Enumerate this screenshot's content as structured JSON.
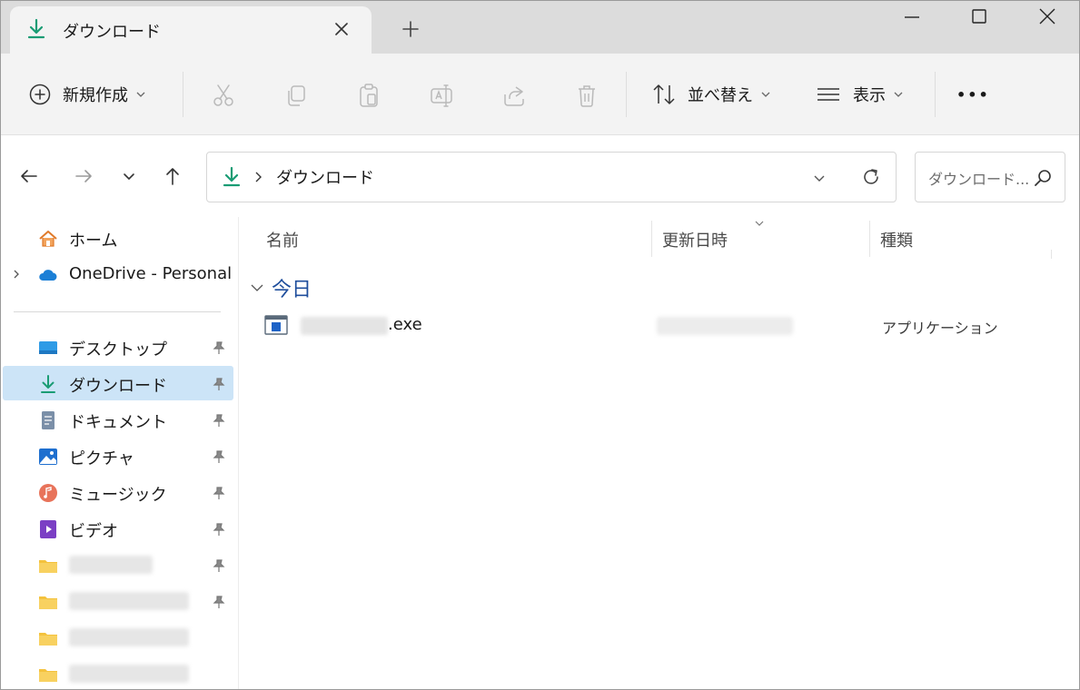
{
  "tab": {
    "title": "ダウンロード"
  },
  "toolbar": {
    "new_label": "新規作成",
    "sort_label": "並べ替え",
    "view_label": "表示",
    "more_label": "•••"
  },
  "address": {
    "path": "ダウンロード",
    "search_placeholder": "ダウンロード..."
  },
  "sidebar": {
    "home": "ホーム",
    "onedrive": "OneDrive - Personal",
    "items": [
      {
        "label": "デスクトップ"
      },
      {
        "label": "ダウンロード"
      },
      {
        "label": "ドキュメント"
      },
      {
        "label": "ピクチャ"
      },
      {
        "label": "ミュージック"
      },
      {
        "label": "ビデオ"
      }
    ]
  },
  "columns": {
    "name": "名前",
    "date": "更新日時",
    "type": "種類"
  },
  "groups": [
    {
      "label": "今日",
      "files": [
        {
          "ext": ".exe",
          "type": "アプリケーション"
        }
      ]
    }
  ],
  "colors": {
    "accent": "#1f4e9c",
    "download_green": "#1a9c74",
    "selected_bg": "#cce4f7",
    "folder_yellow": "#f4c23d"
  }
}
